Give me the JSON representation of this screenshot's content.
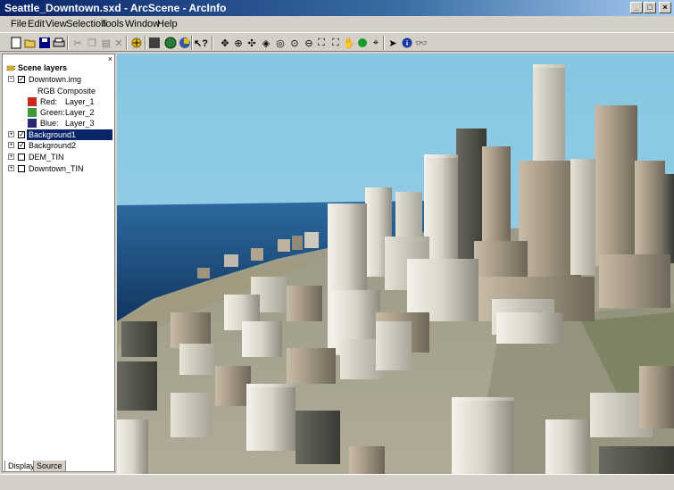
{
  "window": {
    "title": "Seattle_Downtown.sxd - ArcScene - ArcInfo"
  },
  "menu": [
    "File",
    "Edit",
    "View",
    "Selection",
    "Tools",
    "Window",
    "Help"
  ],
  "toc": {
    "root": "Scene layers",
    "layers": [
      {
        "name": "Downtown.img",
        "checked": true,
        "expanded": true
      },
      {
        "name": "Background1",
        "checked": true,
        "selected": true
      },
      {
        "name": "Background2",
        "checked": true
      },
      {
        "name": "DEM_TIN",
        "checked": false
      },
      {
        "name": "Downtown_TIN",
        "checked": false
      }
    ],
    "legend": {
      "title": "RGB Composite",
      "bands": [
        {
          "label": "Red:",
          "value": "Layer_1",
          "color": "#c8281e"
        },
        {
          "label": "Green:",
          "value": "Layer_2",
          "color": "#3c9a3c"
        },
        {
          "label": "Blue:",
          "value": "Layer_3",
          "color": "#28287a"
        }
      ]
    },
    "tabs": [
      "Display",
      "Source"
    ]
  },
  "colors": {
    "titlebar": "#0a246a",
    "sky": "#8ecae6",
    "water": "#1f4f86",
    "selection": "#0a246a"
  }
}
